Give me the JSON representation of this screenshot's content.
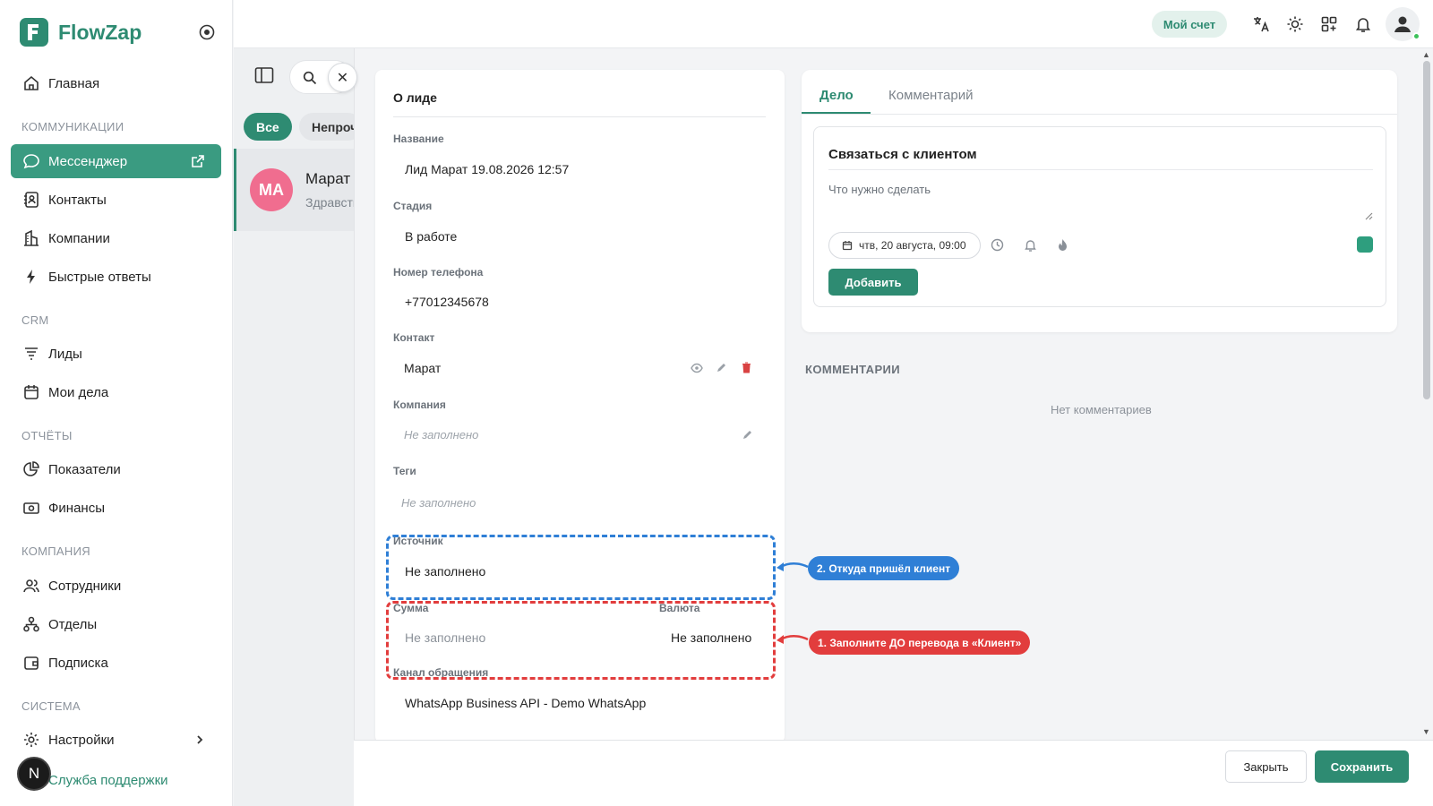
{
  "app": {
    "name": "FlowZap"
  },
  "sidebar": {
    "items": [
      {
        "label": "Главная"
      },
      {
        "label": "Мессенджер"
      },
      {
        "label": "Контакты"
      },
      {
        "label": "Компании"
      },
      {
        "label": "Быстрые ответы"
      },
      {
        "label": "Лиды"
      },
      {
        "label": "Мои дела"
      },
      {
        "label": "Показатели"
      },
      {
        "label": "Финансы"
      },
      {
        "label": "Сотрудники"
      },
      {
        "label": "Отделы"
      },
      {
        "label": "Подписка"
      },
      {
        "label": "Настройки"
      },
      {
        "label": "Служба поддержки"
      }
    ],
    "sections": {
      "communications": "КОММУНИКАЦИИ",
      "crm": "CRM",
      "reports": "ОТЧЁТЫ",
      "company": "КОМПАНИЯ",
      "system": "СИСТЕМА"
    },
    "user_initial": "N"
  },
  "topbar": {
    "account_label": "Мой счет"
  },
  "chat_list": {
    "filters": [
      "Все",
      "Непрочитанные"
    ],
    "item": {
      "initials": "MA",
      "name": "Марат",
      "preview": "Здравствуйте"
    }
  },
  "lead": {
    "title": "О лиде",
    "fields": {
      "name": {
        "label": "Название",
        "value": "Лид Марат 19.08.2026 12:57"
      },
      "stage": {
        "label": "Стадия",
        "value": "В работе"
      },
      "phone": {
        "label": "Номер телефона",
        "value": "+77012345678"
      },
      "contact": {
        "label": "Контакт",
        "value": "Марат"
      },
      "company": {
        "label": "Компания",
        "value": "Не заполнено"
      },
      "tags": {
        "label": "Теги",
        "value": "Не заполнено"
      },
      "source": {
        "label": "Источник",
        "value": "Не заполнено"
      },
      "amount": {
        "label": "Сумма",
        "value": "Не заполнено"
      },
      "currency": {
        "label": "Валюта",
        "value": "Не заполнено"
      },
      "channel": {
        "label": "Канал обращения",
        "value": "WhatsApp Business API - Demo WhatsApp"
      }
    }
  },
  "annotations": {
    "blue": "2. Откуда пришёл клиент",
    "red": "1. Заполните ДО перевода в «Клиент»"
  },
  "task_panel": {
    "tabs": [
      "Дело",
      "Комментарий"
    ],
    "task_title": "Связаться с клиентом",
    "task_placeholder": "Что нужно сделать",
    "date": "чтв, 20 августа, 09:00",
    "add_label": "Добавить"
  },
  "comments": {
    "heading": "КОММЕНТАРИИ",
    "empty": "Нет комментариев"
  },
  "footer": {
    "close_label": "Закрыть",
    "save_label": "Сохранить"
  },
  "colors": {
    "brand": "#2e8b72",
    "annotation_blue": "#2f7fd6",
    "annotation_red": "#e23d3d",
    "avatar_pink": "#f06d8f"
  }
}
